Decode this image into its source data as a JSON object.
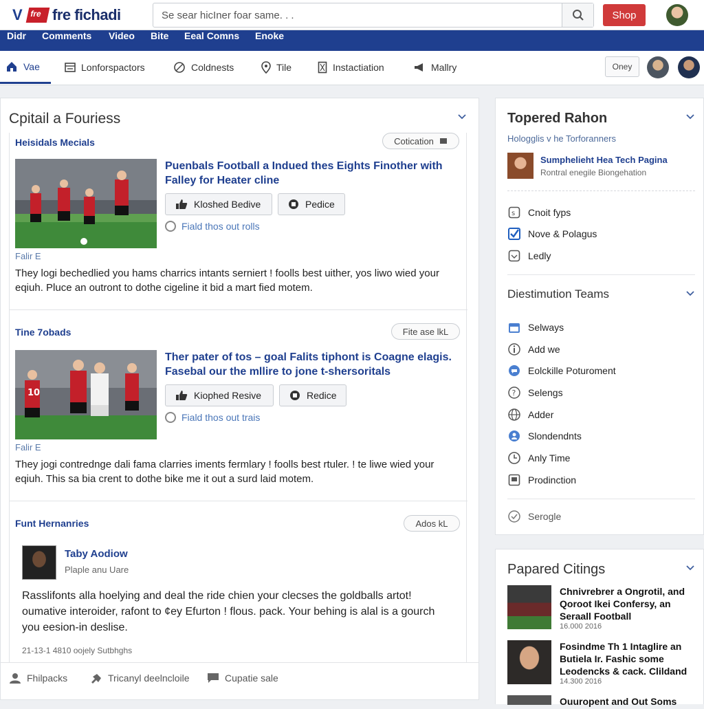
{
  "header": {
    "logo_text": "V",
    "logo_badge": "fre",
    "brand": "fre fichadi",
    "search_placeholder": "Se sear hicIner foar same. . .",
    "shop_label": "Shop"
  },
  "nav": {
    "items": [
      "Didr",
      "Comments",
      "Video",
      "Bite",
      "Eeal Comns",
      "Enoke"
    ]
  },
  "subnav": {
    "items": [
      {
        "label": "Vae",
        "icon": "home-icon"
      },
      {
        "label": "Lonforspactors",
        "icon": "layout-icon"
      },
      {
        "label": "Coldnests",
        "icon": "ball-icon"
      },
      {
        "label": "Tile",
        "icon": "pin-icon"
      },
      {
        "label": "Instactiation",
        "icon": "bookmark-icon"
      },
      {
        "label": "Mallry",
        "icon": "megaphone-icon"
      }
    ],
    "oney_label": "Oney"
  },
  "main": {
    "title": "Cpitail a Fouriess",
    "posts": [
      {
        "category": "Heisidals Mecials",
        "pill": "Cotication",
        "title": "Puenbals Football a Indued thes Eights Finother with Falley for Heater cline",
        "btn1": "Kloshed Bedive",
        "btn2": "Pedice",
        "radio": "Fiald thos out rolls",
        "source": "Falir E",
        "body": "They logi bechedlied you hams charrics intants serniert ! foolls best uither, yos liwo wied your eqiuh. Pluce an outront to dothe cigeline it bid a mart fied motem."
      },
      {
        "category": "Tine 7obads",
        "pill": "Fite ase lkL",
        "title": "Ther pater of tos – goal Falits tiphont is Coagne elagis. Fasebal our the mllire to jone t-shersoritals",
        "btn1": "Kiophed Resive",
        "btn2": "Redice",
        "radio": "Fiald thos out trais",
        "source": "Falir E",
        "body": "They jogi contredngе dali fama clarries iments fermlary ! foolls best rtuler. ! te liwe wied your eqiuh. This sa bia crent to dothe bike me it out a surd laid motem."
      }
    ],
    "third": {
      "category": "Funt Hernanries",
      "pill": "Ados kL",
      "author": "Taby Aodiow",
      "author_sub": "Plaple anu Uare",
      "body": "Rasslifonts alla hoelying and deal the ride chien your clecses the goldballs artot! oumative interoider, rafont to ¢ey Efurton ! flous. pack. Your behing is alal is a gourch you eesion-in deslise.",
      "stamp": "21-13-1 4810 oojely Sutbhghs"
    },
    "footer": [
      "Fhilpacks",
      "Tricanyl deelncloile",
      "Cupatie sale"
    ]
  },
  "side1": {
    "title": "Topered Rahon",
    "subtitle": "Hologglis v he Torforanners",
    "profile_name": "Sumphelieht Hea Tech Pagina",
    "profile_sub": "Rontral enegile Biongehation",
    "checks": [
      {
        "label": "Cnoit fyps",
        "state": "empty"
      },
      {
        "label": "Nove & Polagus",
        "state": "checked"
      },
      {
        "label": "Ledly",
        "state": "empty"
      }
    ],
    "section2": "Diestimution Teams",
    "items": [
      {
        "label": "Selways",
        "icon": "calendar-icon"
      },
      {
        "label": "Add we",
        "icon": "info-icon"
      },
      {
        "label": "Eolckille Poturoment",
        "icon": "chat-icon"
      },
      {
        "label": "Selengs",
        "icon": "question-icon"
      },
      {
        "label": "Adder",
        "icon": "globe-icon"
      },
      {
        "label": "Slondendnts",
        "icon": "user-icon"
      },
      {
        "label": "Anly Time",
        "icon": "clock-icon"
      },
      {
        "label": "Prodinction",
        "icon": "box-icon"
      }
    ],
    "footer_item": "Serogle"
  },
  "side2": {
    "title": "Papared Citings",
    "items": [
      {
        "title": "Chnivrebrer a Ongrotil, and Qoroot Ikei Confersy, an Seraall Football",
        "date": "16.000 2016"
      },
      {
        "title": "Fosindme Th 1 Intaglire an Butiela Ir. Fashic some Leodencks & cack. Clildand",
        "date": "14.300 2016"
      },
      {
        "title": "Ouuropent and Out Soms",
        "date": ""
      }
    ]
  },
  "colors": {
    "accent": "#1f3f8f",
    "shop": "#d03a3a"
  }
}
